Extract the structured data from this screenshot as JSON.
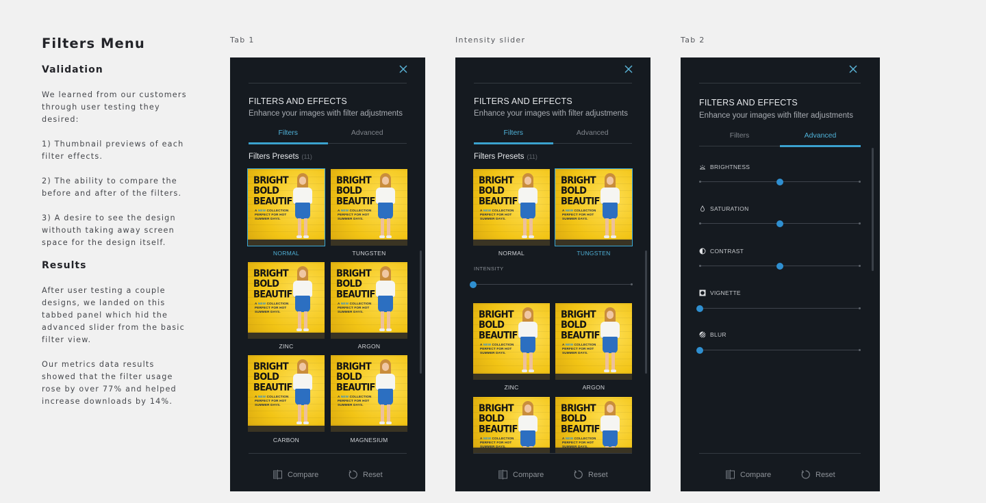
{
  "copy": {
    "title": "Filters Menu",
    "validation_heading": "Validation",
    "validation_intro": "We learned from our customers through user testing they desired:",
    "point1": "1) Thumbnail previews of each filter effects.",
    "point2": "2) The ability to compare the before and after of the filters.",
    "point3": "3) A desire to see the design withouth taking away screen space for the design itself.",
    "results_heading": "Results",
    "results_p1": "After user testing a couple designs, we landed on this tabbed panel which hid the advanced slider from the basic filter view.",
    "results_p2": "Our metrics data results showed that the filter usage rose by over 77% and helped increase downloads by 14%."
  },
  "captions": {
    "tab1": "Tab 1",
    "intensity": "Intensity slider",
    "tab2": "Tab 2"
  },
  "panel": {
    "title": "FILTERS AND EFFECTS",
    "subtitle": "Enhance your images with filter adjustments",
    "tab_filters": "Filters",
    "tab_advanced": "Advanced",
    "presets_label": "Filters Presets",
    "presets_count": "(11)",
    "compare": "Compare",
    "reset": "Reset",
    "intensity_label": "INTENSITY",
    "intensity_value": 0
  },
  "thumb": {
    "headline_1": "BRIGHT",
    "headline_2": "BOLD",
    "headline_3": "BEAUTIFUL",
    "tag_a": "A",
    "tag_new": "NEW",
    "tag_b": "COLLECTION",
    "tag_c": "PERFECT FOR HOT",
    "tag_d": "SUMMER DAYS."
  },
  "filters": {
    "normal": "NORMAL",
    "tungsten": "TUNGSTEN",
    "zinc": "ZINC",
    "argon": "ARGON",
    "carbon": "CARBON",
    "magnesium": "MAGNESIUM"
  },
  "advanced": {
    "brightness": {
      "label": "BRIGHTNESS",
      "value": 0.5
    },
    "saturation": {
      "label": "SATURATION",
      "value": 0.5
    },
    "contrast": {
      "label": "CONTRAST",
      "value": 0.5
    },
    "vignette": {
      "label": "VIGNETTE",
      "value": 0
    },
    "blur": {
      "label": "BLUR",
      "value": 0
    }
  },
  "colors": {
    "accent": "#3ba2cf",
    "panel_bg": "#151a20",
    "thumb_yellow": "#f6c91d"
  }
}
